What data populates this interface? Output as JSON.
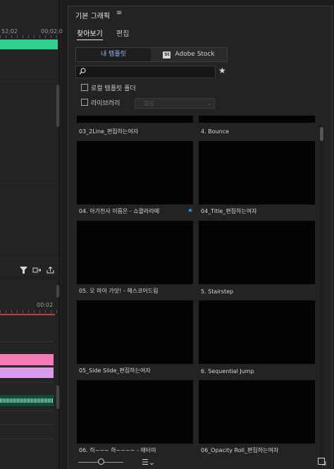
{
  "timeline_top": {
    "ruler_labels": [
      "52;02",
      "00;02;0"
    ],
    "clip_color": "#2fcf8f",
    "icons": [
      "filter-icon",
      "export-frame-icon",
      "share-icon"
    ]
  },
  "timeline_bottom": {
    "ruler_label": "00:02",
    "playhead_color": "#d4383a",
    "clip_colors": [
      "#f47ab6",
      "#d79be9",
      "#0e4d3c"
    ]
  },
  "panel": {
    "title": "기본 그래픽",
    "menu_glyph": "≡",
    "tabs": [
      "찾아보기",
      "편집"
    ],
    "source_toggle": {
      "local": "내 템플릿",
      "stock": "Adobe Stock",
      "stock_logo": "St"
    },
    "search": {
      "value": "",
      "placeholder": ""
    },
    "local_folder_label": "로컬 템플릿 폴더",
    "library_label": "라이브러리",
    "library_dropdown": "없음",
    "accent": "#8fb7f3",
    "favorite_color": "#3b8ff2"
  },
  "templates": [
    {
      "caption": "03_2Line_편집하는여자",
      "favorite": false
    },
    {
      "caption": "4. Bounce",
      "favorite": false
    },
    {
      "caption": "04. 아기천사 이름은 - 쇼콸라라떼",
      "favorite": true
    },
    {
      "caption": "04_Title_편집하는여자",
      "favorite": false
    },
    {
      "caption": "05. 오 마이 가앗! - 헤스코어드림",
      "favorite": false
    },
    {
      "caption": "5. Stairstep",
      "favorite": false
    },
    {
      "caption": "05_Side Slide_편집하는여자",
      "favorite": false
    },
    {
      "caption": "6. Sequential Jump",
      "favorite": false
    },
    {
      "caption": "06. 히~~~ 하~~~~ - 애터미",
      "favorite": false
    },
    {
      "caption": "06_Opacity Roll_편집하는여자",
      "favorite": false
    }
  ],
  "bottom_bar": {
    "thumbnail_size": 0.45,
    "list_icon": "☰⌄"
  }
}
